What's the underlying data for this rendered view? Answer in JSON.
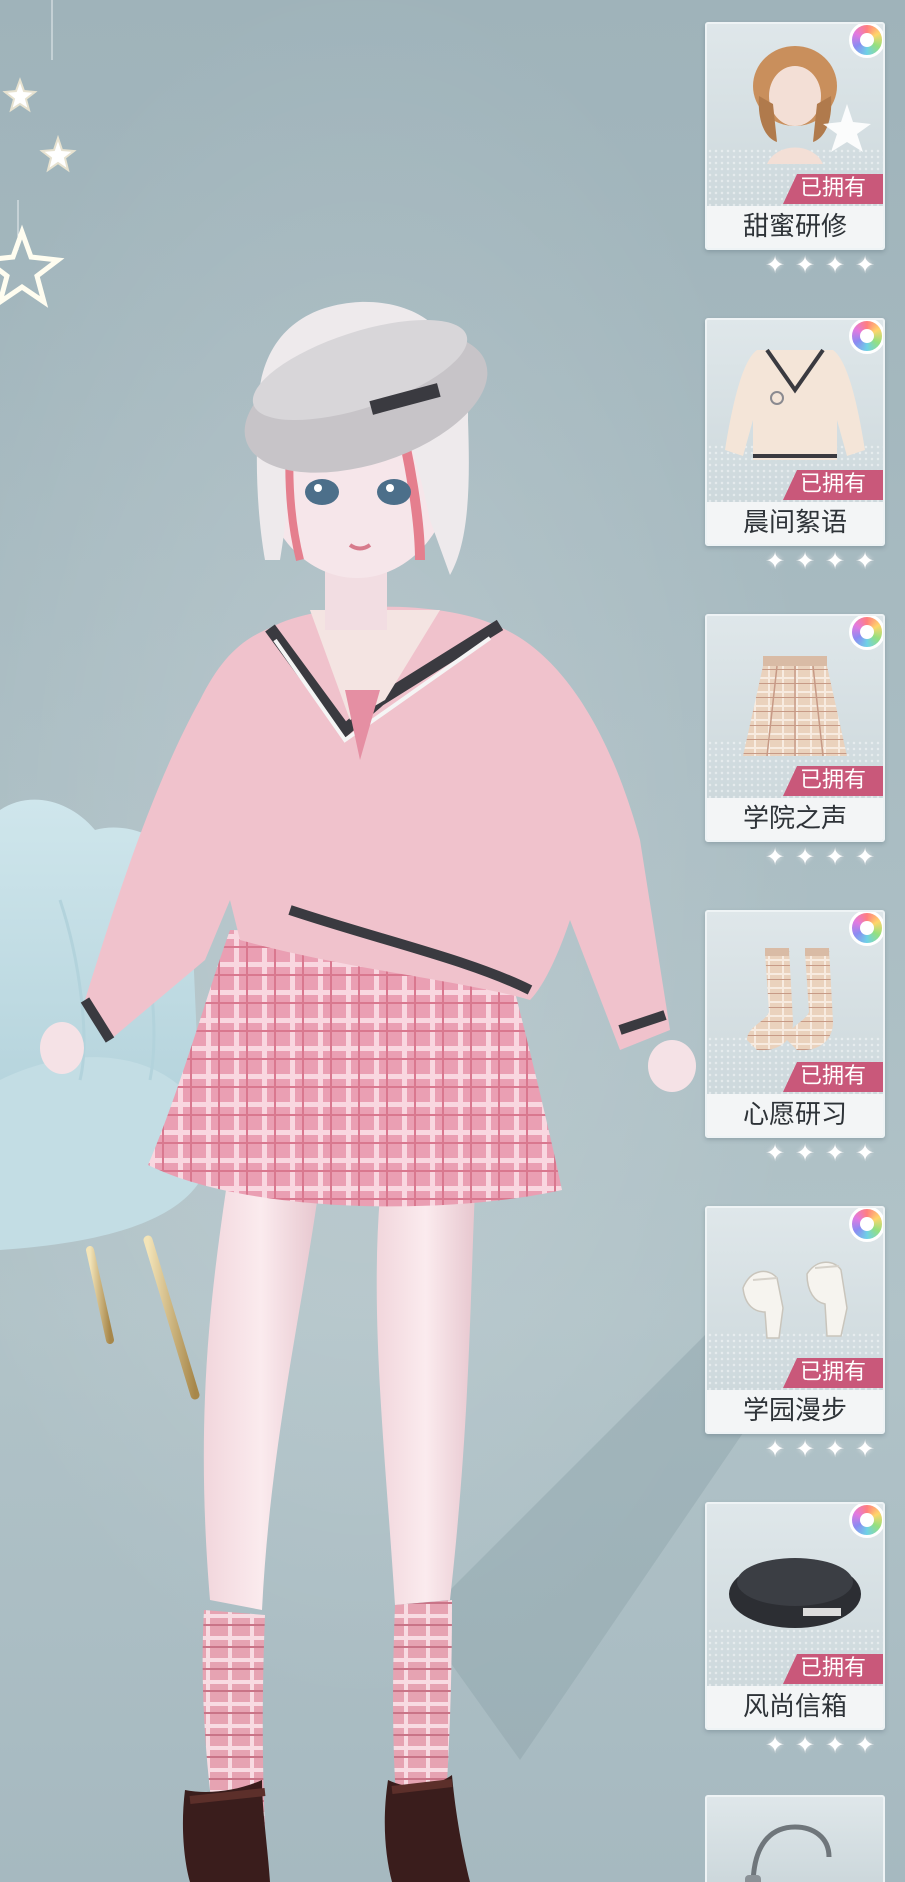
{
  "outfit_items": [
    {
      "name": "甜蜜研修",
      "status": "已拥有",
      "stars": 4,
      "icon": "hair-icon"
    },
    {
      "name": "晨间絮语",
      "status": "已拥有",
      "stars": 4,
      "icon": "sweater-icon"
    },
    {
      "name": "学院之声",
      "status": "已拥有",
      "stars": 4,
      "icon": "skirt-icon"
    },
    {
      "name": "心愿研习",
      "status": "已拥有",
      "stars": 4,
      "icon": "socks-icon"
    },
    {
      "name": "学园漫步",
      "status": "已拥有",
      "stars": 4,
      "icon": "shoes-icon"
    },
    {
      "name": "风尚信箱",
      "status": "已拥有",
      "stars": 4,
      "icon": "beret-icon"
    }
  ],
  "partial_item": {
    "icon": "headphones-icon"
  },
  "colors": {
    "owned_badge": "#c9587a",
    "background": "#a9bcc2",
    "sweater": "#f2c3cd",
    "skirt_plaid": "#e99bb0"
  }
}
